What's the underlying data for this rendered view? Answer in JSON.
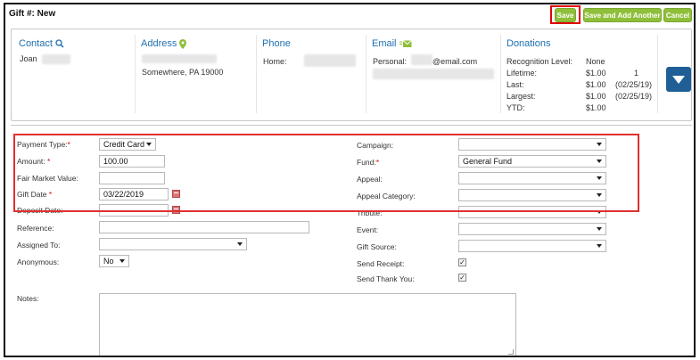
{
  "header": {
    "title": "Gift #: New",
    "save_label": "Save",
    "save_add_label": "Save and Add Another",
    "cancel_label": "Cancel"
  },
  "contact": {
    "heading": "Contact",
    "first_name": "Joan",
    "address_heading": "Address",
    "address_line": "Somewhere, PA 19000",
    "phone_heading": "Phone",
    "phone_label": "Home:",
    "email_heading": "Email",
    "email_label": "Personal:",
    "email_domain": "@email.com"
  },
  "donations": {
    "heading": "Donations",
    "recognition_label": "Recognition Level:",
    "recognition_value": "None",
    "rows": [
      {
        "label": "Lifetime:",
        "amount": "$1.00",
        "extra": "1"
      },
      {
        "label": "Last:",
        "amount": "$1.00",
        "extra": "(02/25/19)"
      },
      {
        "label": "Largest:",
        "amount": "$1.00",
        "extra": "(02/25/19)"
      },
      {
        "label": "YTD:",
        "amount": "$1.00",
        "extra": ""
      }
    ]
  },
  "form": {
    "payment_type_label": "Payment Type:",
    "payment_type_value": "Credit Card",
    "amount_label": "Amount:",
    "amount_value": "100.00",
    "fair_market_label": "Fair Market Value:",
    "gift_date_label": "Gift Date",
    "gift_date_value": "03/22/2019",
    "deposit_date_label": "Deposit Date:",
    "reference_label": "Reference:",
    "assigned_to_label": "Assigned To:",
    "anonymous_label": "Anonymous:",
    "anonymous_value": "No",
    "notes_label": "Notes:",
    "campaign_label": "Campaign:",
    "fund_label": "Fund:",
    "fund_value": "General Fund",
    "appeal_label": "Appeal:",
    "appeal_category_label": "Appeal Category:",
    "tribute_label": "Tribute:",
    "event_label": "Event:",
    "gift_source_label": "Gift Source:",
    "send_receipt_label": "Send Receipt:",
    "send_thank_you_label": "Send Thank You:",
    "required_mark": "*"
  },
  "colors": {
    "accent_green": "#8fbf3a",
    "link_blue": "#1e6fb0",
    "dark_blue": "#1f5f95",
    "highlight_red": "#e03030"
  },
  "icons": {
    "contact": "search-icon",
    "address": "map-pin-icon",
    "email": "envelope-icon",
    "collapse": "chevron-down-icon",
    "date": "calendar-icon"
  }
}
